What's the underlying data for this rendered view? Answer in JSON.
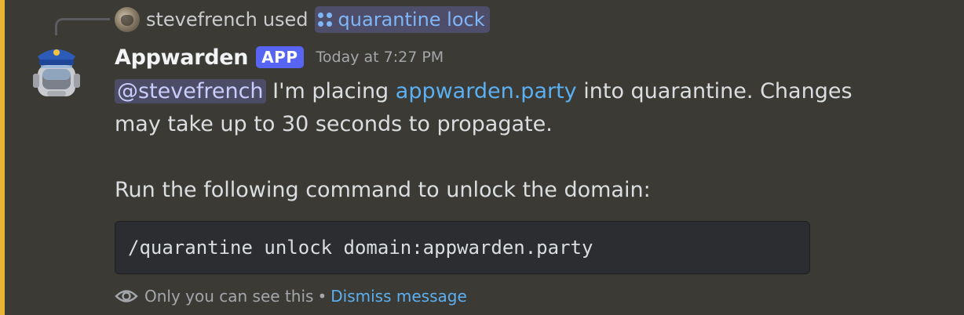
{
  "reply": {
    "username": "stevefrench",
    "used_text": "used",
    "command_name": "quarantine lock"
  },
  "message": {
    "author": "Appwarden",
    "badge": "APP",
    "timestamp": "Today at 7:27 PM",
    "mention": "@stevefrench",
    "text_before_link": " I'm placing ",
    "link_text": "appwarden.party",
    "text_after_link": " into quarantine. Changes may take up to 30 seconds to propagate.",
    "instruction": "Run the following command to unlock the domain:",
    "code": "/quarantine unlock domain:appwarden.party"
  },
  "ephemeral": {
    "notice": "Only you can see this",
    "separator": "•",
    "dismiss_label": "Dismiss message"
  },
  "icons": {
    "command": "slash-command-icon",
    "eye": "eye-icon",
    "bot_avatar": "police-robot-icon"
  },
  "colors": {
    "background": "#3c3a35",
    "accent_bar": "#e8b234",
    "app_badge": "#5865f2",
    "link": "#5ab0f2",
    "mention_bg": "#4c4c67",
    "code_bg": "#2b2d31"
  }
}
